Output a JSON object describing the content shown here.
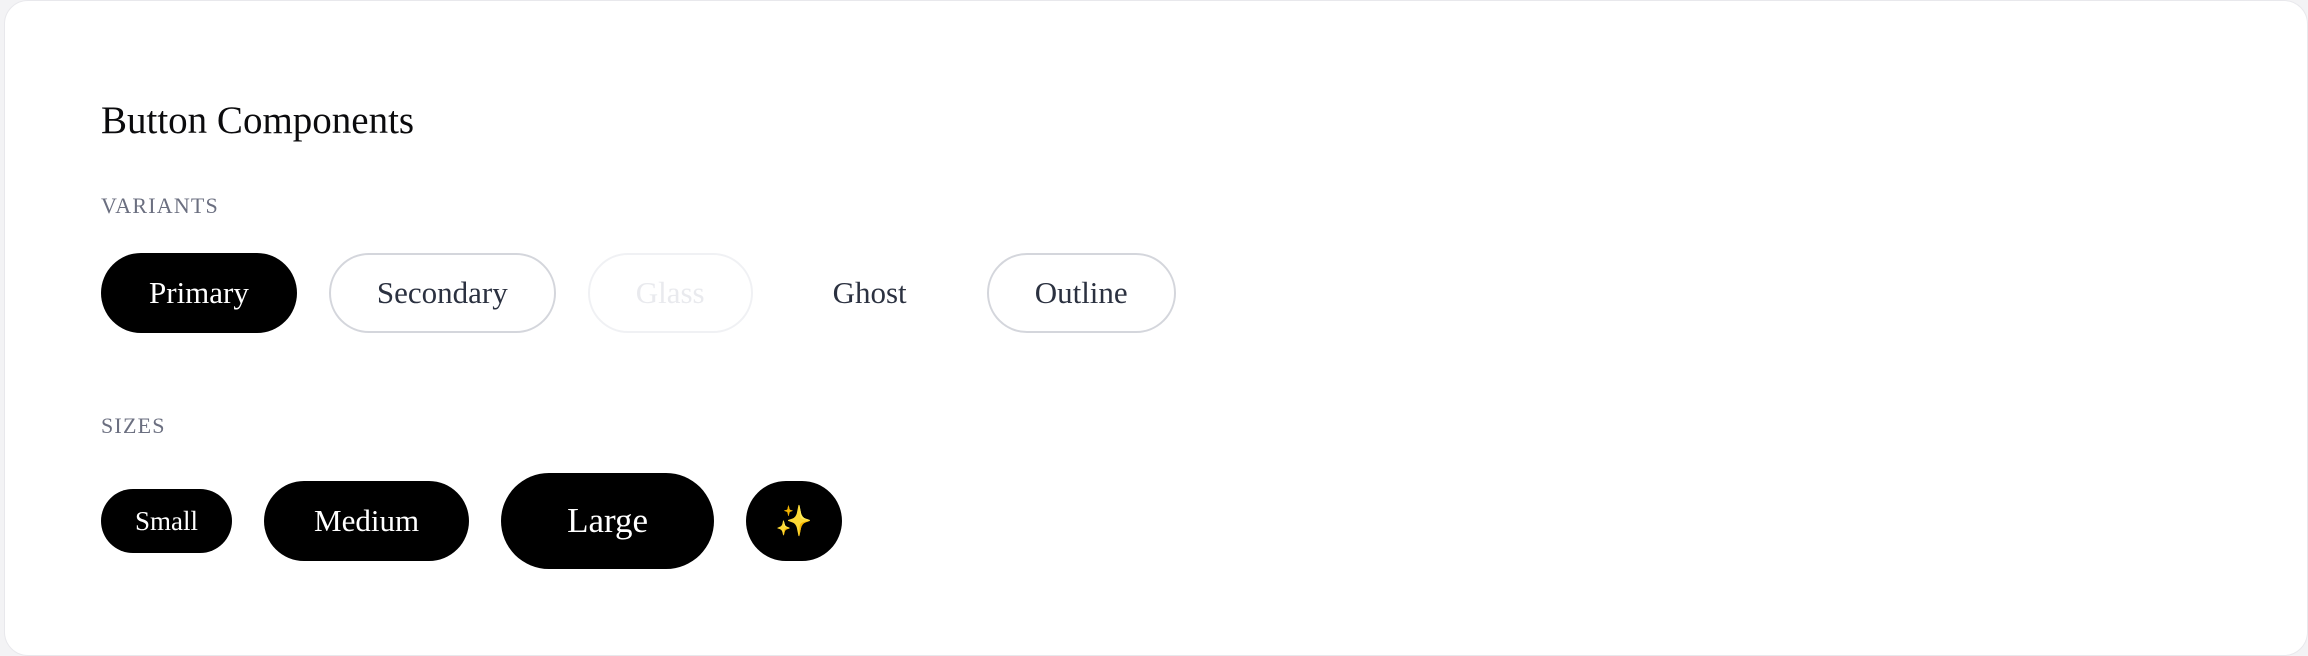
{
  "page": {
    "title": "Button Components"
  },
  "variants": {
    "label": "VARIANTS",
    "buttons": {
      "primary": "Primary",
      "secondary": "Secondary",
      "glass": "Glass",
      "ghost": "Ghost",
      "outline": "Outline"
    }
  },
  "sizes": {
    "label": "SIZES",
    "buttons": {
      "small": "Small",
      "medium": "Medium",
      "large": "Large",
      "icon": "✨"
    }
  },
  "colors": {
    "primary_bg": "#000000",
    "primary_text": "#ffffff",
    "secondary_text": "#2b3140",
    "border": "#d4d6dc",
    "label_text": "#6b6f80"
  }
}
